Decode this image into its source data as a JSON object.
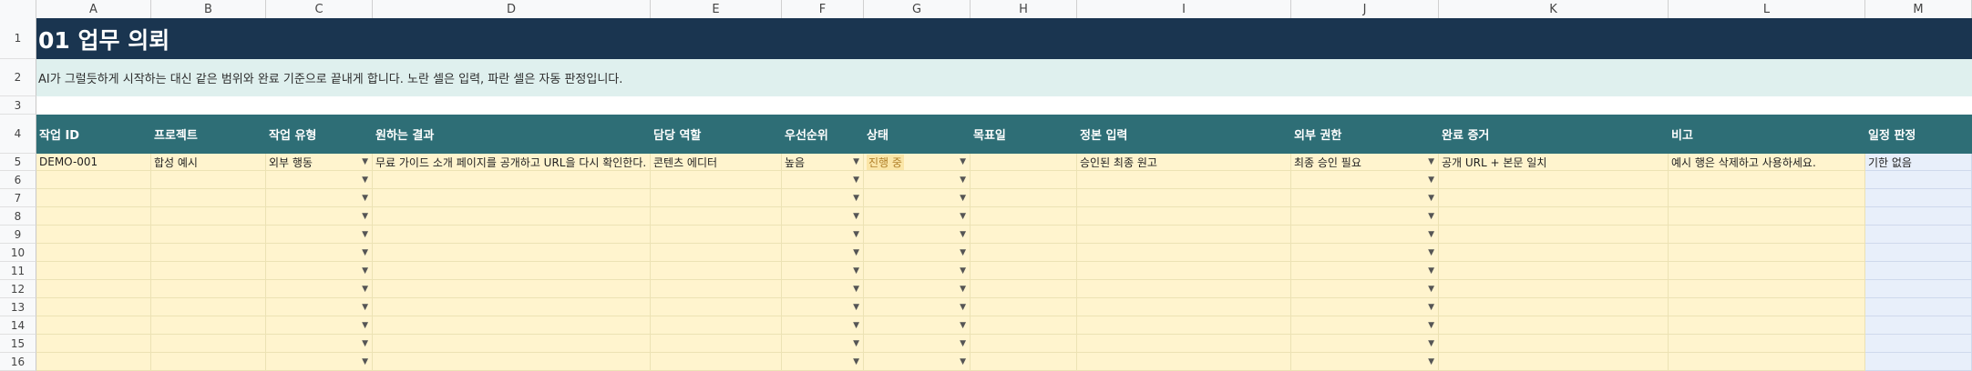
{
  "columns": [
    "A",
    "B",
    "C",
    "D",
    "E",
    "F",
    "G",
    "H",
    "I",
    "J",
    "K",
    "L",
    "M"
  ],
  "rows": {
    "numbers": [
      "1",
      "2",
      "3",
      "4",
      "5",
      "6",
      "7",
      "8",
      "9",
      "10",
      "11",
      "12",
      "13",
      "14",
      "15",
      "16"
    ]
  },
  "title": "01 업무 의뢰",
  "subtitle": "AI가 그럴듯하게 시작하는 대신 같은 범위와 완료 기준으로 끝내게 합니다. 노란 셀은 입력, 파란 셀은 자동 판정입니다.",
  "headers": [
    "작업 ID",
    "프로젝트",
    "작업 유형",
    "원하는 결과",
    "담당 역할",
    "우선순위",
    "상태",
    "목표일",
    "정본 입력",
    "외부 권한",
    "완료 증거",
    "비고",
    "일정 판정"
  ],
  "example_row": {
    "task_id": "DEMO-001",
    "project": "합성 예시",
    "task_type": "외부 행동",
    "desired_result": "무료 가이드 소개 페이지를 공개하고 URL을 다시 확인한다.",
    "owner_role": "콘텐츠 에디터",
    "priority": "높음",
    "status": "진행 중",
    "target_date": "",
    "canonical_input": "승인된 최종 원고",
    "external_permission": "최종 승인 필요",
    "completion_evidence": "공개 URL + 본문 일치",
    "note": "예시 행은 삭제하고 사용하세요.",
    "schedule_verdict": "기한 없음"
  },
  "dropdown_icon": "▼",
  "colors": {
    "title_band": "#1a3550",
    "subtitle_band": "#dff0ee",
    "header_band": "#2e6e76",
    "input_cell": "#fff4ce",
    "auto_cell": "#e8effa",
    "status_highlight": "#fbe6a8"
  }
}
